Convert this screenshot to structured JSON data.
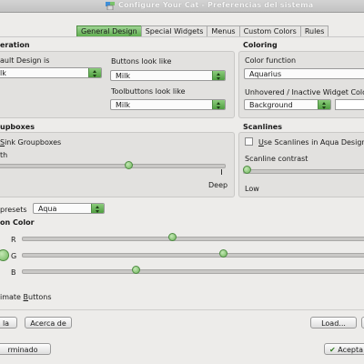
{
  "window": {
    "title": "Configure Your Cat - Preferencias del sistema"
  },
  "tabs": [
    {
      "label": "General Design",
      "active": true
    },
    {
      "label": "Special Widgets",
      "active": false
    },
    {
      "label": "Menus",
      "active": false
    },
    {
      "label": "Custom Colors",
      "active": false
    },
    {
      "label": "Rules",
      "active": false
    }
  ],
  "generation": {
    "title": "eration",
    "default_design_label": "ault Design is",
    "default_design_value": "lk",
    "buttons_look_label": "Buttons look like",
    "buttons_look_value": "Milk",
    "toolbuttons_look_label": "Toolbuttons look like",
    "toolbuttons_look_value": "Milk"
  },
  "coloring": {
    "title": "Coloring",
    "color_function_label": "Color function",
    "color_function_value": "Aquarius",
    "unhovered_label": "Unhovered / Inactive Widget Color",
    "unhovered_value": "Background"
  },
  "groupboxes": {
    "title": "upboxes",
    "sink_label": "Sink Groupboxes",
    "depth_label": "th",
    "deep_label": "Deep"
  },
  "scanlines": {
    "title": "Scanlines",
    "use_label": "Use Scanlines in Aqua Design",
    "use_checked": false,
    "contrast_label": "Scanline contrast",
    "low_label": "Low"
  },
  "presets": {
    "label": "presets",
    "value": "Aqua"
  },
  "icon_color": {
    "title": "on Color",
    "channels": [
      {
        "label": "R",
        "level": 0.45
      },
      {
        "label": "G",
        "level": 0.6
      },
      {
        "label": "B",
        "level": 0.33
      }
    ]
  },
  "animate": {
    "label": "imate Buttons"
  },
  "bottom_buttons": {
    "help": "la",
    "about": "Acerca de",
    "load": "Load...",
    "finished": "rminado",
    "accept": "Acepta"
  },
  "colors": {
    "accent": "#5fae4f",
    "background": "#edecea"
  }
}
